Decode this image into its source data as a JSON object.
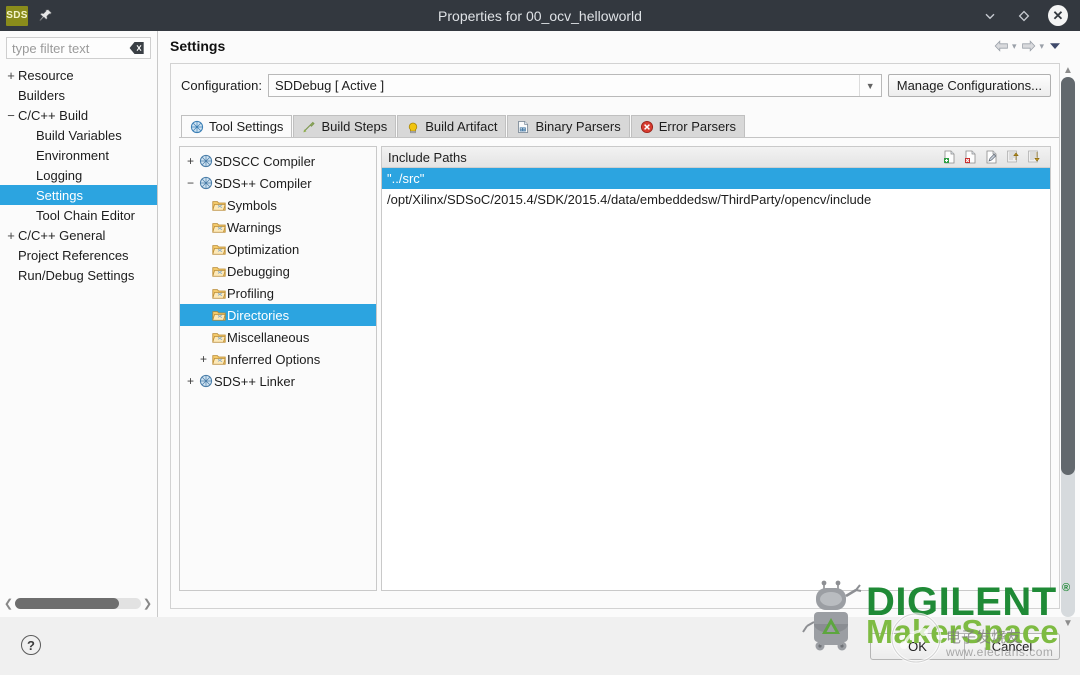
{
  "window": {
    "logo_text": "SDS",
    "title": "Properties for 00_ocv_helloworld",
    "minimize_label": "∨",
    "maximize_label": "◇",
    "close_label": "✕"
  },
  "left_pane": {
    "filter_placeholder": "type filter text",
    "filter_value": "",
    "tree": [
      {
        "label": "Resource",
        "expander": "+",
        "indent": 1,
        "selected": false
      },
      {
        "label": "Builders",
        "expander": "",
        "indent": 1,
        "selected": false
      },
      {
        "label": "C/C++ Build",
        "expander": "−",
        "indent": 1,
        "selected": false
      },
      {
        "label": "Build Variables",
        "expander": "",
        "indent": 2,
        "selected": false
      },
      {
        "label": "Environment",
        "expander": "",
        "indent": 2,
        "selected": false
      },
      {
        "label": "Logging",
        "expander": "",
        "indent": 2,
        "selected": false
      },
      {
        "label": "Settings",
        "expander": "",
        "indent": 2,
        "selected": true
      },
      {
        "label": "Tool Chain Editor",
        "expander": "",
        "indent": 2,
        "selected": false
      },
      {
        "label": "C/C++ General",
        "expander": "+",
        "indent": 1,
        "selected": false
      },
      {
        "label": "Project References",
        "expander": "",
        "indent": 1,
        "selected": false
      },
      {
        "label": "Run/Debug Settings",
        "expander": "",
        "indent": 1,
        "selected": false
      }
    ]
  },
  "header": {
    "title": "Settings",
    "back_label": "back-arrow",
    "forward_label": "forward-arrow",
    "menu_label": "view-menu"
  },
  "configuration": {
    "label": "Configuration:",
    "value": "SDDebug  [ Active ]",
    "manage_button": "Manage Configurations..."
  },
  "tabs": [
    {
      "label": "Tool Settings",
      "icon": "tool-settings-icon",
      "active": true
    },
    {
      "label": "Build Steps",
      "icon": "build-steps-icon",
      "active": false
    },
    {
      "label": "Build Artifact",
      "icon": "build-artifact-icon",
      "active": false
    },
    {
      "label": "Binary Parsers",
      "icon": "binary-parsers-icon",
      "active": false
    },
    {
      "label": "Error Parsers",
      "icon": "error-parsers-icon",
      "active": false
    }
  ],
  "tool_tree": [
    {
      "label": "SDSCC Compiler",
      "expander": "+",
      "icon": "compiler-icon",
      "indent": 1,
      "selected": false
    },
    {
      "label": "SDS++ Compiler",
      "expander": "−",
      "icon": "compiler-icon",
      "indent": 1,
      "selected": false
    },
    {
      "label": "Symbols",
      "expander": "",
      "icon": "folder-icon",
      "indent": 2,
      "selected": false
    },
    {
      "label": "Warnings",
      "expander": "",
      "icon": "folder-icon",
      "indent": 2,
      "selected": false
    },
    {
      "label": "Optimization",
      "expander": "",
      "icon": "folder-icon",
      "indent": 2,
      "selected": false
    },
    {
      "label": "Debugging",
      "expander": "",
      "icon": "folder-icon",
      "indent": 2,
      "selected": false
    },
    {
      "label": "Profiling",
      "expander": "",
      "icon": "folder-icon",
      "indent": 2,
      "selected": false
    },
    {
      "label": "Directories",
      "expander": "",
      "icon": "folder-icon",
      "indent": 2,
      "selected": true
    },
    {
      "label": "Miscellaneous",
      "expander": "",
      "icon": "folder-icon",
      "indent": 2,
      "selected": false
    },
    {
      "label": "Inferred Options",
      "expander": "+",
      "icon": "folder-icon",
      "indent": 2,
      "selected": false
    },
    {
      "label": "SDS++ Linker",
      "expander": "+",
      "icon": "compiler-icon",
      "indent": 1,
      "selected": false
    }
  ],
  "include_paths": {
    "title": "Include Paths",
    "tools": [
      {
        "name": "add-icon",
        "title": "Add"
      },
      {
        "name": "delete-icon",
        "title": "Delete"
      },
      {
        "name": "edit-icon",
        "title": "Edit"
      },
      {
        "name": "move-up-icon",
        "title": "Move Up"
      },
      {
        "name": "move-down-icon",
        "title": "Move Down"
      }
    ],
    "rows": [
      {
        "value": "\"../src\"",
        "selected": true
      },
      {
        "value": "/opt/Xilinx/SDSoC/2015.4/SDK/2015.4/data/embeddedsw/ThirdParty/opencv/include",
        "selected": false
      }
    ]
  },
  "footer": {
    "help_label": "?",
    "ok_label": "OK",
    "cancel_label": "Cancel"
  },
  "watermarks": {
    "digilent": "DIGILENT",
    "digilent_reg": "®",
    "makerspace": "MakerSpace",
    "elecfans_cn": "电子发烧友",
    "elecfans_url": "www.elecfans.com"
  },
  "colors": {
    "titlebar": "#33383f",
    "selection": "#2ca4e0",
    "digilent_green": "#1f8a36",
    "maker_green": "#7ebb42",
    "logo_olive": "#8a8c1b"
  }
}
